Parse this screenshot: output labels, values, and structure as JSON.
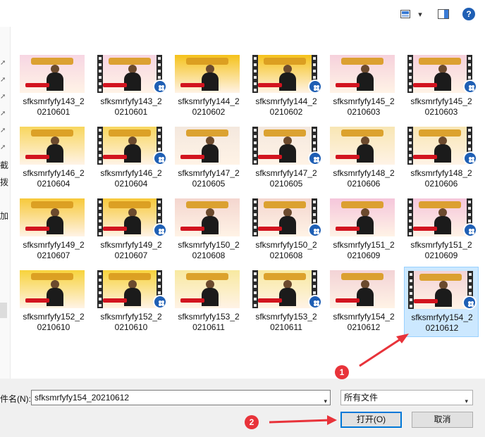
{
  "toolbar": {
    "view_icon": "view-options-icon",
    "chevron": "▾",
    "pane_icon": "preview-pane-icon",
    "help_label": "?"
  },
  "sidebar": {
    "partial_labels": [
      "截",
      "拨",
      "加"
    ]
  },
  "files": [
    {
      "name": "sfksmrfyfy143_2\n0210601",
      "type": "image",
      "bg": "#f7d6e3"
    },
    {
      "name": "sfksmrfyfy143_2\n0210601",
      "type": "video",
      "bg": "#f7d6e3"
    },
    {
      "name": "sfksmrfyfy144_2\n0210602",
      "type": "image",
      "bg": "#f5c21a"
    },
    {
      "name": "sfksmrfyfy144_2\n0210602",
      "type": "video",
      "bg": "#f5c21a"
    },
    {
      "name": "sfksmrfyfy145_2\n0210603",
      "type": "image",
      "bg": "#f6d1dc"
    },
    {
      "name": "sfksmrfyfy145_2\n0210603",
      "type": "video",
      "bg": "#f6d1dc"
    },
    {
      "name": "sfksmrfyfy146_2\n0210604",
      "type": "image",
      "bg": "#f8d65e"
    },
    {
      "name": "sfksmrfyfy146_2\n0210604",
      "type": "video",
      "bg": "#f8d65e"
    },
    {
      "name": "sfksmrfyfy147_2\n0210605",
      "type": "image",
      "bg": "#f4e8de"
    },
    {
      "name": "sfksmrfyfy147_2\n0210605",
      "type": "video",
      "bg": "#f4e8de"
    },
    {
      "name": "sfksmrfyfy148_2\n0210606",
      "type": "image",
      "bg": "#f8e6b4"
    },
    {
      "name": "sfksmrfyfy148_2\n0210606",
      "type": "video",
      "bg": "#f8e6b4"
    },
    {
      "name": "sfksmrfyfy149_2\n0210607",
      "type": "image",
      "bg": "#f7c93a"
    },
    {
      "name": "sfksmrfyfy149_2\n0210607",
      "type": "video",
      "bg": "#f7c93a"
    },
    {
      "name": "sfksmrfyfy150_2\n0210608",
      "type": "image",
      "bg": "#f4d6cf"
    },
    {
      "name": "sfksmrfyfy150_2\n0210608",
      "type": "video",
      "bg": "#f4d6cf"
    },
    {
      "name": "sfksmrfyfy151_2\n0210609",
      "type": "image",
      "bg": "#f5c6db"
    },
    {
      "name": "sfksmrfyfy151_2\n0210609",
      "type": "video",
      "bg": "#f5c6db"
    },
    {
      "name": "sfksmrfyfy152_2\n0210610",
      "type": "image",
      "bg": "#f7d33c"
    },
    {
      "name": "sfksmrfyfy152_2\n0210610",
      "type": "video",
      "bg": "#f7d33c"
    },
    {
      "name": "sfksmrfyfy153_2\n0210611",
      "type": "image",
      "bg": "#f8e9a0"
    },
    {
      "name": "sfksmrfyfy153_2\n0210611",
      "type": "video",
      "bg": "#f8e9a0"
    },
    {
      "name": "sfksmrfyfy154_2\n0210612",
      "type": "image",
      "bg": "#f3d3d6"
    },
    {
      "name": "sfksmrfyfy154_2\n0210612",
      "type": "video",
      "bg": "#f3d3d6",
      "selected": true
    }
  ],
  "footer": {
    "filename_label": "件名(N):",
    "filename_value": "sfksmrfyfy154_20210612",
    "filetype_value": "所有文件",
    "open_label": "打开(O)",
    "cancel_label": "取消",
    "dropdown_glyph": "▾"
  },
  "annotations": {
    "marker1": "1",
    "marker2": "2",
    "color": "#e8333a"
  }
}
